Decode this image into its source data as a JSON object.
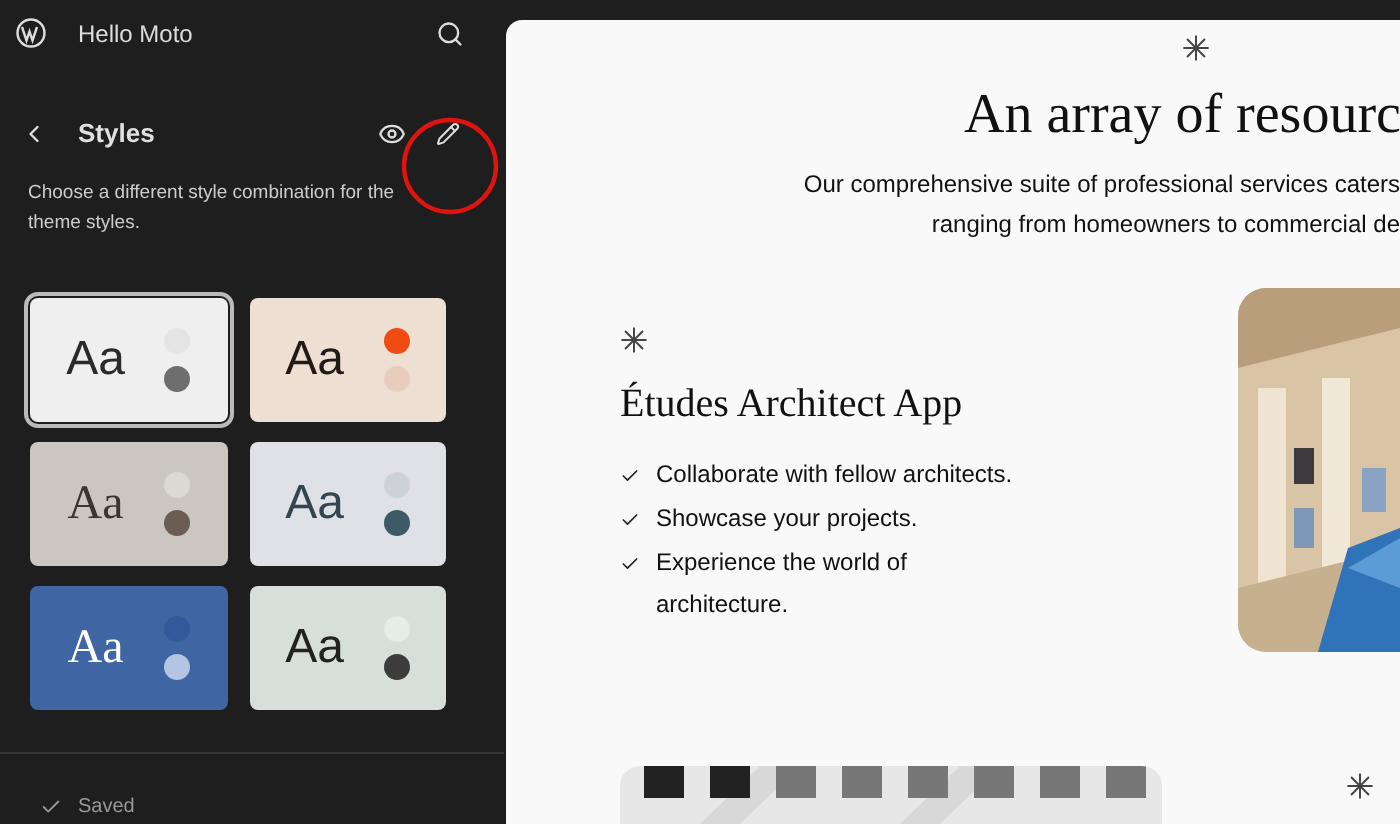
{
  "topbar": {
    "site_title": "Hello Moto"
  },
  "panel": {
    "title": "Styles",
    "description": "Choose a different style combination for the theme styles."
  },
  "variations": [
    {
      "kind": "sans",
      "selected": true,
      "color": "#efefef",
      "sample": {
        "label": "Aa",
        "color": "#2a2a2a"
      },
      "swatches": [
        {
          "color": "#e4e4e4"
        },
        {
          "color": "#6e6e6e"
        }
      ]
    },
    {
      "kind": "sans",
      "selected": false,
      "color": "#eddfd2",
      "sample": {
        "label": "Aa",
        "color": "#221a16"
      },
      "swatches": [
        {
          "color": "#f24a13"
        },
        {
          "color": "#e8cdbc"
        }
      ]
    },
    {
      "kind": "serif",
      "selected": false,
      "color": "#cbc6c0",
      "sample": {
        "label": "Aa",
        "color": "#3b3430"
      },
      "swatches": [
        {
          "color": "#dcd8d3"
        },
        {
          "color": "#6b5d53"
        }
      ]
    },
    {
      "kind": "sans",
      "selected": false,
      "color": "#dfe1e6",
      "sample": {
        "label": "Aa",
        "color": "#33464f"
      },
      "swatches": [
        {
          "color": "#cdd2d8"
        },
        {
          "color": "#3e5a67"
        }
      ]
    },
    {
      "kind": "serif",
      "selected": false,
      "color": "#3f66a3",
      "sample": {
        "label": "Aa",
        "color": "#ffffff"
      },
      "swatches": [
        {
          "color": "#34599a"
        },
        {
          "color": "#b3c5e0"
        }
      ]
    },
    {
      "kind": "sans",
      "selected": false,
      "color": "#d6dfda",
      "sample": {
        "label": "Aa",
        "color": "#222222"
      },
      "swatches": [
        {
          "color": "#e6ece8"
        },
        {
          "color": "#3c3c3c"
        }
      ]
    }
  ],
  "footer": {
    "status": "Saved"
  },
  "preview": {
    "heading": "An array of resourc",
    "intro_lines": [
      "Our comprehensive suite of professional services caters",
      "ranging from homeowners to commercial de"
    ],
    "feature": {
      "title": "Études Architect App",
      "items": [
        "Collaborate with fellow architects.",
        "Showcase your projects.",
        "Experience the world of architecture."
      ]
    }
  }
}
